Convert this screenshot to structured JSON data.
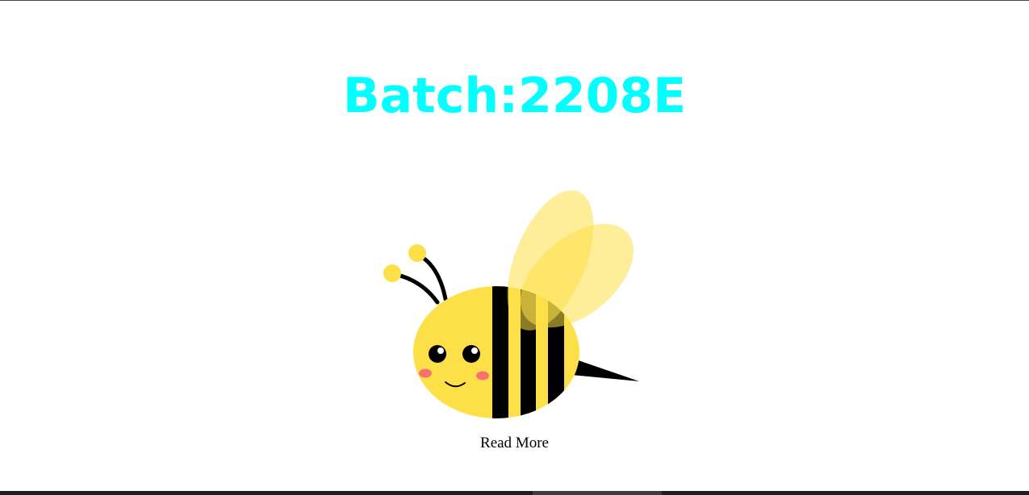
{
  "header": {
    "title": "Batch:2208E"
  },
  "hero": {
    "image_name": "bee-illustration",
    "link_label": "Read More"
  },
  "colors": {
    "title": "#00ffff",
    "bee_body": "#fde047",
    "bee_stripes": "#000000",
    "wing": "#fde047",
    "cheeks": "#f87171"
  }
}
